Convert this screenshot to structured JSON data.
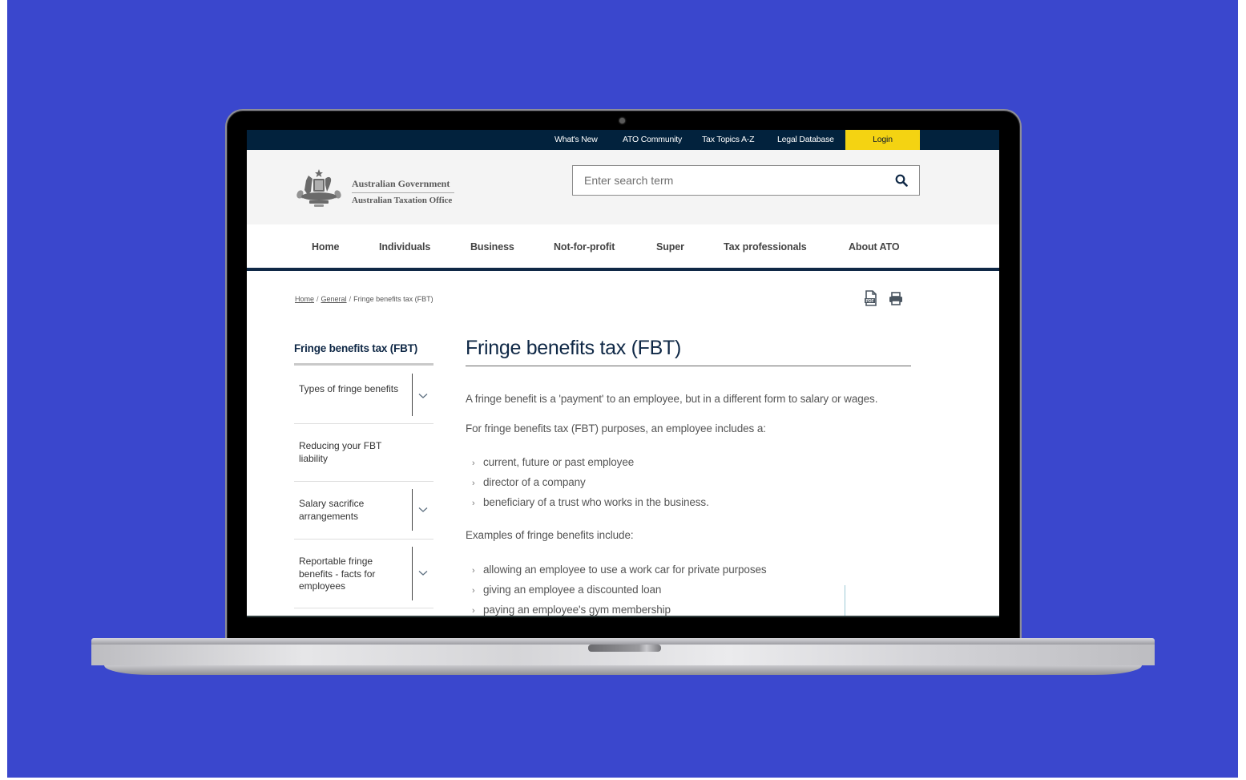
{
  "colors": {
    "background": "#3a47cd",
    "topbar": "#02223d",
    "login_accent": "#f4d312",
    "brand_navy": "#0f2846"
  },
  "topbar": {
    "links": [
      "What's New",
      "ATO Community",
      "Tax Topics A-Z",
      "Legal Database"
    ],
    "login": "Login"
  },
  "header": {
    "logo_line1": "Australian Government",
    "logo_line2": "Australian Taxation Office",
    "search_placeholder": "Enter search term",
    "search_icon": "search-icon"
  },
  "nav": {
    "items": [
      "Home",
      "Individuals",
      "Business",
      "Not-for-profit",
      "Super",
      "Tax professionals",
      "About ATO"
    ]
  },
  "breadcrumb": {
    "items": [
      "Home",
      "General"
    ],
    "current": "Fringe benefits tax (FBT)",
    "separator": "/"
  },
  "tools": {
    "pdf_icon": "pdf-icon",
    "print_icon": "print-icon"
  },
  "sidebar": {
    "title": "Fringe benefits tax (FBT)",
    "items": [
      {
        "label": "Types of fringe benefits",
        "expandable": true
      },
      {
        "label": "Reducing your FBT liability",
        "expandable": false
      },
      {
        "label": "Salary sacrifice arrangements",
        "expandable": true
      },
      {
        "label": "Reportable fringe benefits - facts for employees",
        "expandable": true
      }
    ]
  },
  "main": {
    "title": "Fringe benefits tax (FBT)",
    "para1": "A fringe benefit is a 'payment' to an employee, but in a different form to salary or wages.",
    "para2": "For fringe benefits tax (FBT) purposes, an employee includes a:",
    "list1": [
      "current, future or past employee",
      "director of a company",
      "beneficiary of a trust who works in the business."
    ],
    "para3": "Examples of fringe benefits include:",
    "list2": [
      "allowing an employee to use a work car for private purposes",
      "giving an employee a discounted loan",
      "paying an employee's gym membership"
    ],
    "bullet_glyph": "›"
  }
}
